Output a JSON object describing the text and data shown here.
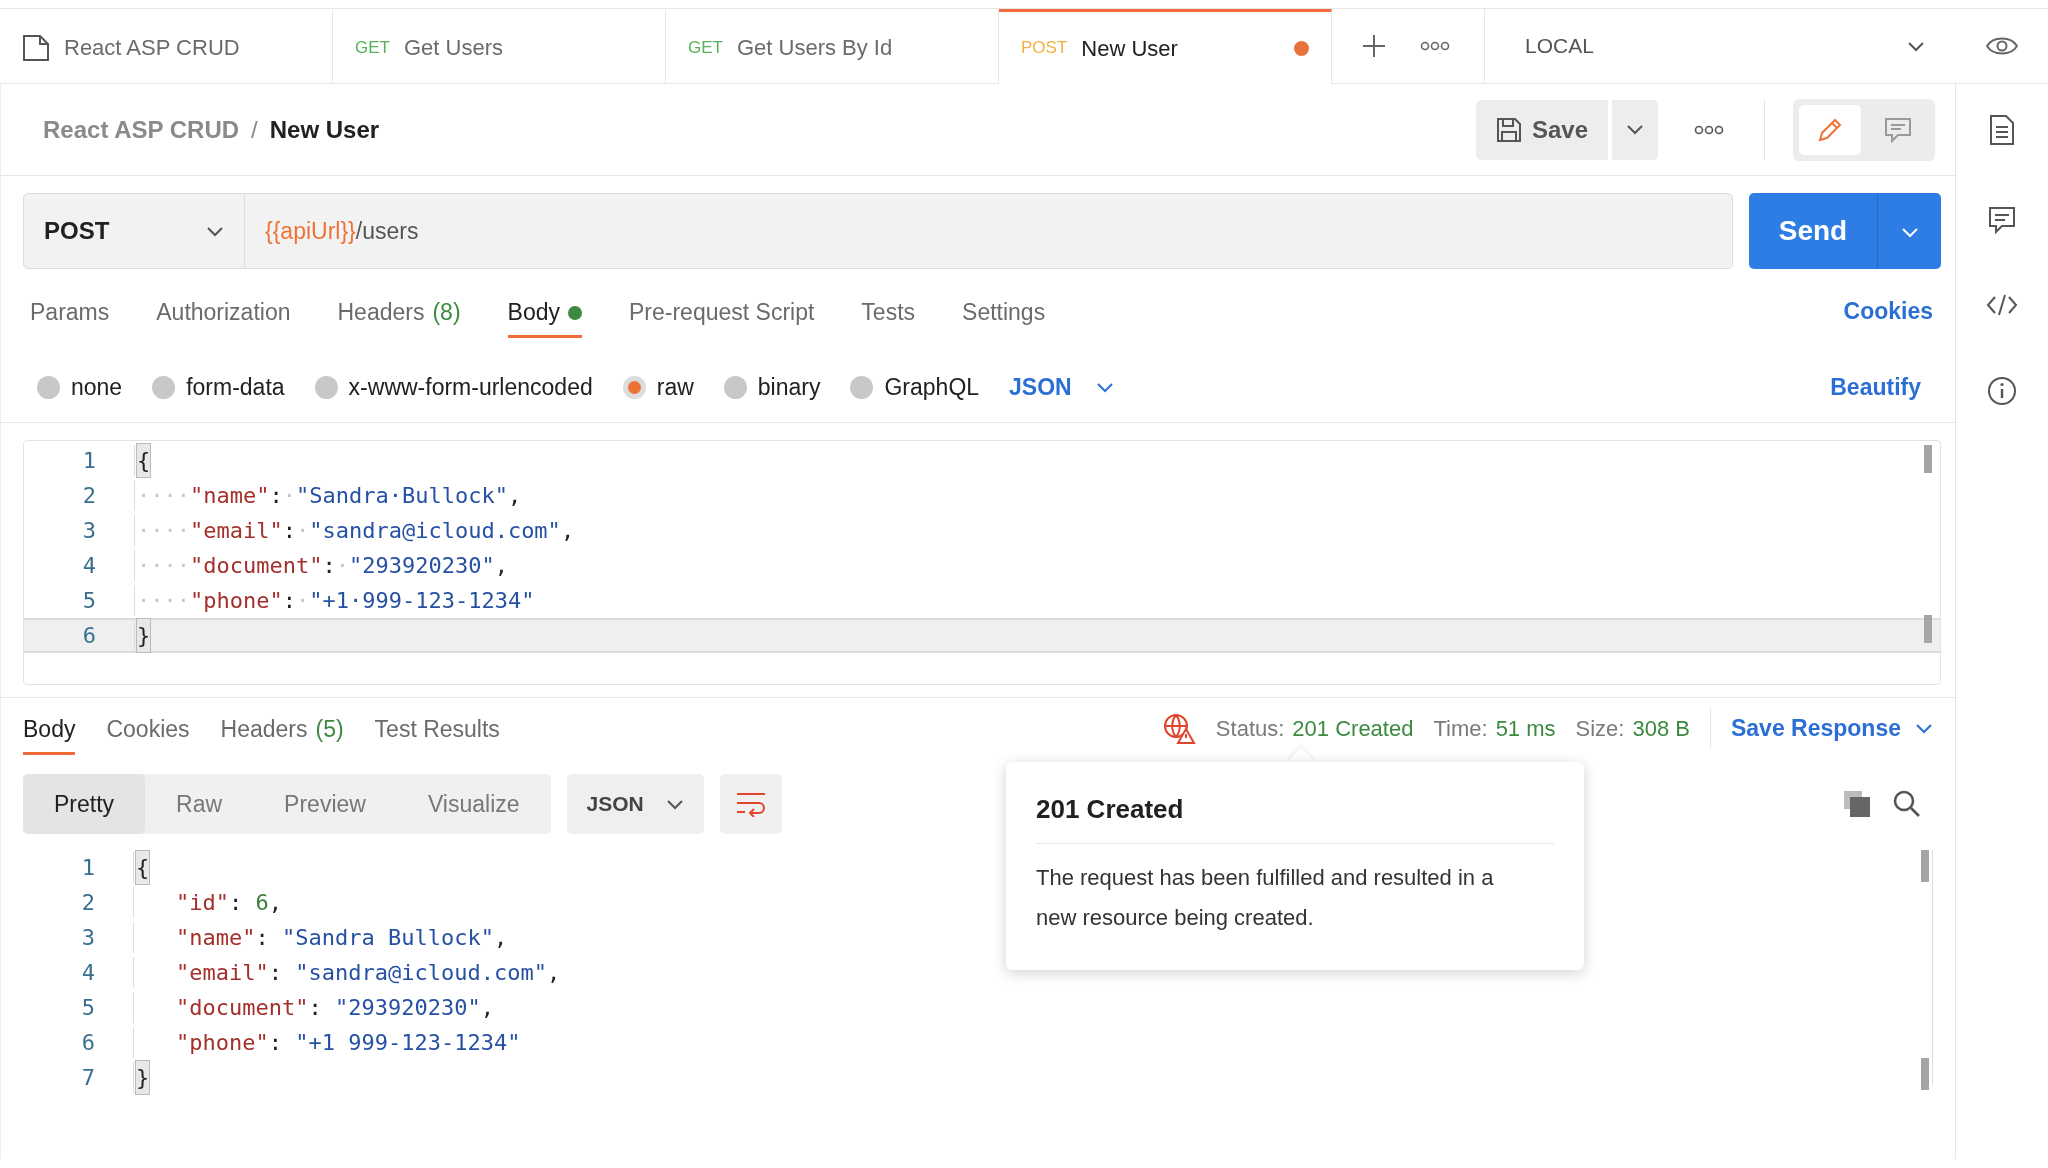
{
  "tabs": [
    {
      "kind": "collection",
      "title": "React ASP CRUD",
      "selected": false,
      "unsaved": false
    },
    {
      "kind": "request",
      "method": "GET",
      "title": "Get Users",
      "selected": false,
      "unsaved": false
    },
    {
      "kind": "request",
      "method": "GET",
      "title": "Get Users By Id",
      "selected": false,
      "unsaved": false
    },
    {
      "kind": "request",
      "method": "POST",
      "title": "New User",
      "selected": true,
      "unsaved": true
    }
  ],
  "environment": "LOCAL",
  "breadcrumb": {
    "collection": "React ASP CRUD",
    "separator": "/",
    "request": "New User"
  },
  "save_button": "Save",
  "modes": [
    {
      "kind": "edit",
      "selected": true
    },
    {
      "kind": "comment",
      "selected": false
    }
  ],
  "request": {
    "method": "POST",
    "url_variable": "{{apiUrl}}",
    "url_path": "/users",
    "send": "Send"
  },
  "request_tabs": [
    {
      "label": "Params",
      "dot": false,
      "selected": false
    },
    {
      "label": "Authorization",
      "dot": false,
      "selected": false
    },
    {
      "label": "Headers",
      "count": "(8)",
      "dot": false,
      "selected": false
    },
    {
      "label": "Body",
      "dot": true,
      "selected": true
    },
    {
      "label": "Pre-request Script",
      "dot": false,
      "selected": false
    },
    {
      "label": "Tests",
      "dot": false,
      "selected": false
    },
    {
      "label": "Settings",
      "dot": false,
      "selected": false
    }
  ],
  "cookies_link": "Cookies",
  "body_types": [
    {
      "label": "none",
      "selected": false
    },
    {
      "label": "form-data",
      "selected": false
    },
    {
      "label": "x-www-form-urlencoded",
      "selected": false
    },
    {
      "label": "raw",
      "selected": true
    },
    {
      "label": "binary",
      "selected": false
    },
    {
      "label": "GraphQL",
      "selected": false
    }
  ],
  "body_language": "JSON",
  "beautify": "Beautify",
  "request_body": [
    {
      "number": "1",
      "active": false,
      "tokens": [
        {
          "kind": "bracket",
          "text": "{"
        }
      ]
    },
    {
      "number": "2",
      "active": false,
      "tokens": [
        {
          "kind": "ws",
          "text": "····"
        },
        {
          "kind": "key",
          "text": "\"name\""
        },
        {
          "kind": "punct",
          "text": ":"
        },
        {
          "kind": "ws",
          "text": "·"
        },
        {
          "kind": "string",
          "text": "\"Sandra·Bullock\""
        },
        {
          "kind": "punct",
          "text": ","
        }
      ]
    },
    {
      "number": "3",
      "active": false,
      "tokens": [
        {
          "kind": "ws",
          "text": "····"
        },
        {
          "kind": "key",
          "text": "\"email\""
        },
        {
          "kind": "punct",
          "text": ":"
        },
        {
          "kind": "ws",
          "text": "·"
        },
        {
          "kind": "string",
          "text": "\"sandra@icloud.com\""
        },
        {
          "kind": "punct",
          "text": ","
        }
      ]
    },
    {
      "number": "4",
      "active": false,
      "tokens": [
        {
          "kind": "ws",
          "text": "····"
        },
        {
          "kind": "key",
          "text": "\"document\""
        },
        {
          "kind": "punct",
          "text": ":"
        },
        {
          "kind": "ws",
          "text": "·"
        },
        {
          "kind": "string",
          "text": "\"293920230\""
        },
        {
          "kind": "punct",
          "text": ","
        }
      ]
    },
    {
      "number": "5",
      "active": false,
      "tokens": [
        {
          "kind": "ws",
          "text": "····"
        },
        {
          "kind": "key",
          "text": "\"phone\""
        },
        {
          "kind": "punct",
          "text": ":"
        },
        {
          "kind": "ws",
          "text": "·"
        },
        {
          "kind": "string",
          "text": "\"+1·999-123-1234\""
        }
      ]
    },
    {
      "number": "6",
      "active": true,
      "tokens": [
        {
          "kind": "bracket",
          "text": "}"
        }
      ]
    }
  ],
  "response_tabs": [
    {
      "label": "Body",
      "selected": true
    },
    {
      "label": "Cookies",
      "selected": false
    },
    {
      "label": "Headers",
      "count": "(5)",
      "selected": false
    },
    {
      "label": "Test Results",
      "selected": false
    }
  ],
  "status": [
    {
      "label": "Status:",
      "value": "201 Created"
    },
    {
      "label": "Time:",
      "value": "51 ms"
    },
    {
      "label": "Size:",
      "value": "308 B"
    }
  ],
  "save_response": "Save Response",
  "view_modes": [
    {
      "label": "Pretty",
      "selected": true
    },
    {
      "label": "Raw",
      "selected": false
    },
    {
      "label": "Preview",
      "selected": false
    },
    {
      "label": "Visualize",
      "selected": false
    }
  ],
  "response_format": "JSON",
  "wrap_lines": true,
  "response_body": [
    {
      "number": "1",
      "indent": false,
      "tokens": [
        {
          "kind": "bracket",
          "text": "{"
        }
      ]
    },
    {
      "number": "2",
      "indent": true,
      "tokens": [
        {
          "kind": "key",
          "text": "\"id\""
        },
        {
          "kind": "punct",
          "text": ": "
        },
        {
          "kind": "number",
          "text": "6"
        },
        {
          "kind": "punct",
          "text": ","
        }
      ]
    },
    {
      "number": "3",
      "indent": true,
      "tokens": [
        {
          "kind": "key",
          "text": "\"name\""
        },
        {
          "kind": "punct",
          "text": ": "
        },
        {
          "kind": "string",
          "text": "\"Sandra Bullock\""
        },
        {
          "kind": "punct",
          "text": ","
        }
      ]
    },
    {
      "number": "4",
      "indent": true,
      "tokens": [
        {
          "kind": "key",
          "text": "\"email\""
        },
        {
          "kind": "punct",
          "text": ": "
        },
        {
          "kind": "string",
          "text": "\"sandra@icloud.com\""
        },
        {
          "kind": "punct",
          "text": ","
        }
      ]
    },
    {
      "number": "5",
      "indent": true,
      "tokens": [
        {
          "kind": "key",
          "text": "\"document\""
        },
        {
          "kind": "punct",
          "text": ": "
        },
        {
          "kind": "string",
          "text": "\"293920230\""
        },
        {
          "kind": "punct",
          "text": ","
        }
      ]
    },
    {
      "number": "6",
      "indent": true,
      "tokens": [
        {
          "kind": "key",
          "text": "\"phone\""
        },
        {
          "kind": "punct",
          "text": ": "
        },
        {
          "kind": "string",
          "text": "\"+1 999-123-1234\""
        }
      ]
    },
    {
      "number": "7",
      "indent": false,
      "tokens": [
        {
          "kind": "bracket",
          "text": "}"
        }
      ]
    }
  ],
  "tooltip": {
    "title": "201 Created",
    "text": "The request has been fulfilled and resulted in a new resource being created."
  }
}
